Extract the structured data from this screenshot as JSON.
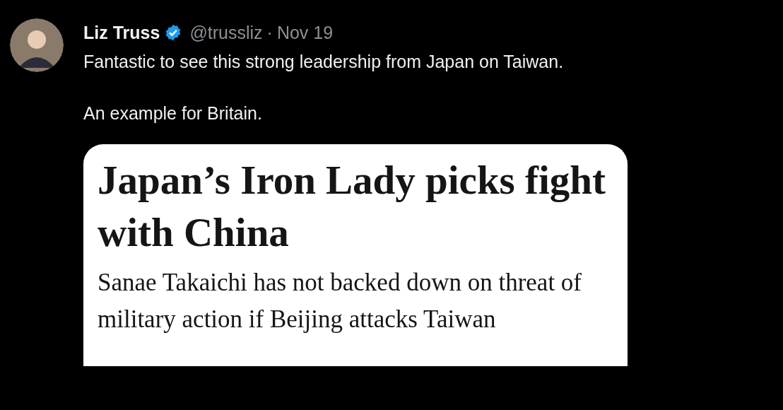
{
  "tweet": {
    "author_name": "Liz Truss",
    "verified": true,
    "handle": "@trussliz",
    "separator": "·",
    "date": "Nov 19",
    "paragraphs": [
      "Fantastic to see this strong leadership from Japan on Taiwan.",
      "An example for Britain."
    ],
    "card": {
      "headline": "Japan’s Iron Lady picks fight with China",
      "subheadline": "Sanae Takaichi has not backed down on threat of military action if Beijing attacks Taiwan"
    }
  }
}
